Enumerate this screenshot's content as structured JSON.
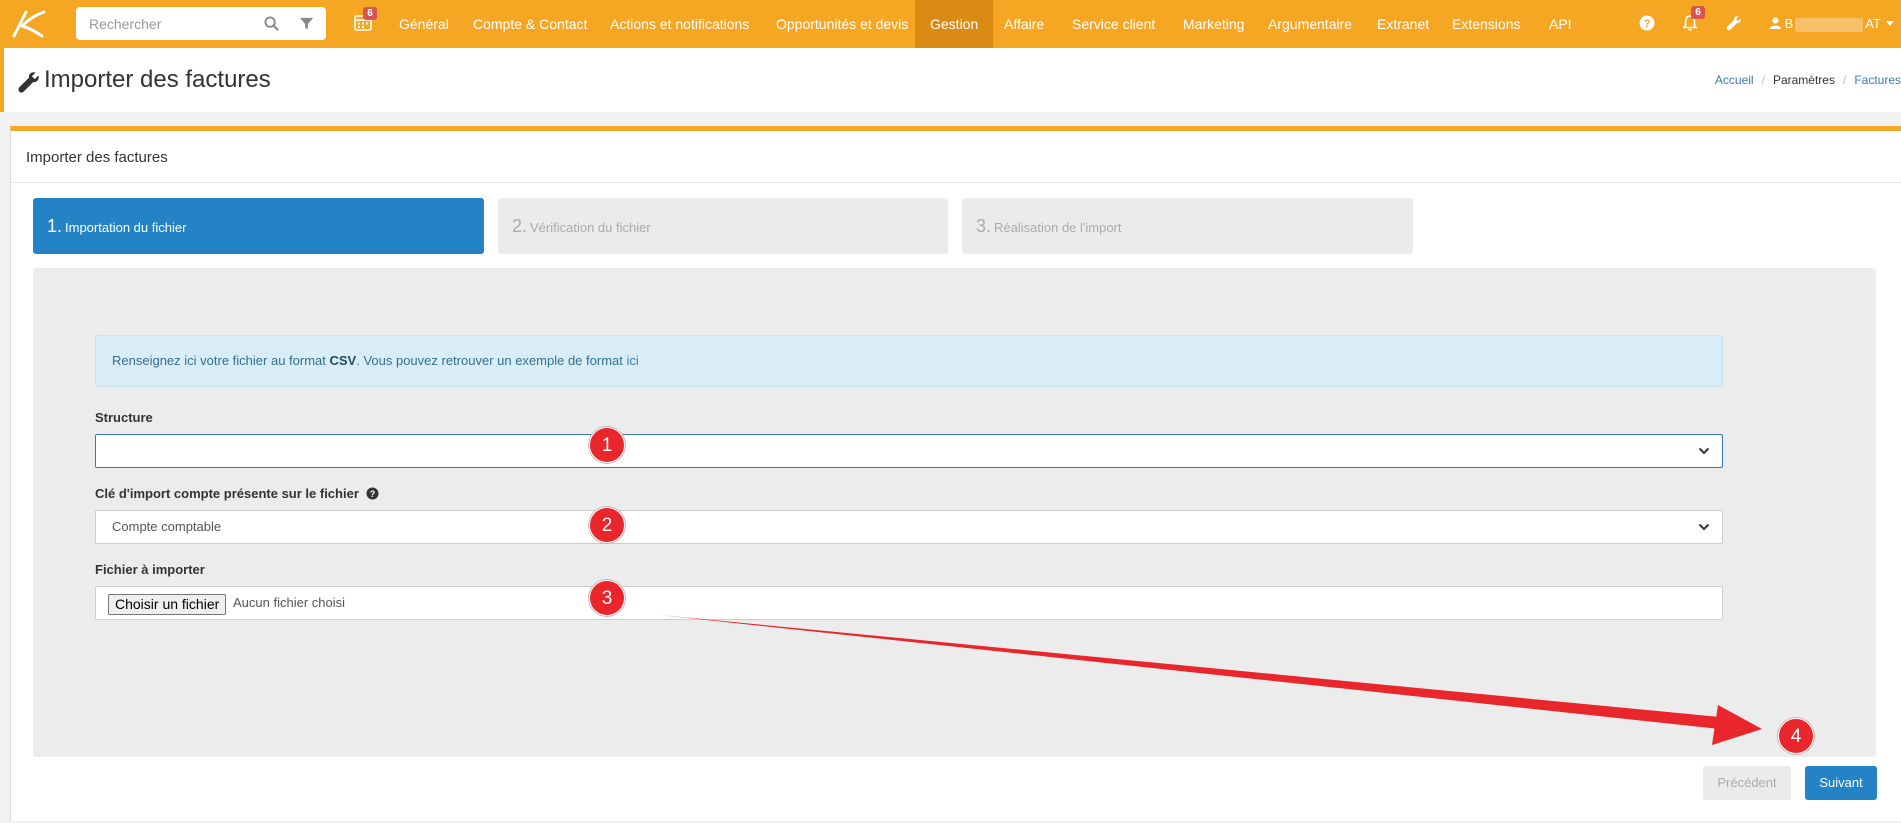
{
  "navbar": {
    "search_placeholder": "Rechercher",
    "calendar_badge": "6",
    "notifications_badge": "6",
    "menu": [
      "Général",
      "Compte & Contact",
      "Actions et notifications",
      "Opportunités et devis",
      "Gestion",
      "Affaire",
      "Service client",
      "Marketing",
      "Argumentaire",
      "Extranet",
      "Extensions",
      "API"
    ],
    "active_menu": "Gestion",
    "user_initial": "B",
    "user_suffix": "AT",
    "accent_color": "#f5a623"
  },
  "page": {
    "title": "Importer des factures",
    "breadcrumb": [
      "Accueil",
      "Paramètres",
      "Factures"
    ]
  },
  "panel": {
    "title": "Importer des factures",
    "steps": [
      {
        "num": "1.",
        "label": "Importation du fichier",
        "active": true
      },
      {
        "num": "2.",
        "label": "Vérification du fichier",
        "active": false
      },
      {
        "num": "3.",
        "label": "Réalisation de l'import",
        "active": false
      }
    ],
    "info": {
      "before": "Renseignez ici votre fichier au format ",
      "format": "CSV",
      "middle": ". Vous pouvez retrouver un exemple de format ",
      "link": "ici"
    },
    "structure_label": "Structure",
    "structure_value": "",
    "import_key_label": "Clé d'import compte présente sur le fichier",
    "import_key_value": "Compte comptable",
    "file_label": "Fichier à importer",
    "file_button": "Choisir un fichier",
    "file_status": "Aucun fichier choisi",
    "prev_button": "Précédent",
    "next_button": "Suivant"
  },
  "annotations": [
    "1",
    "2",
    "3",
    "4"
  ],
  "annotation_color": "#e8262b"
}
